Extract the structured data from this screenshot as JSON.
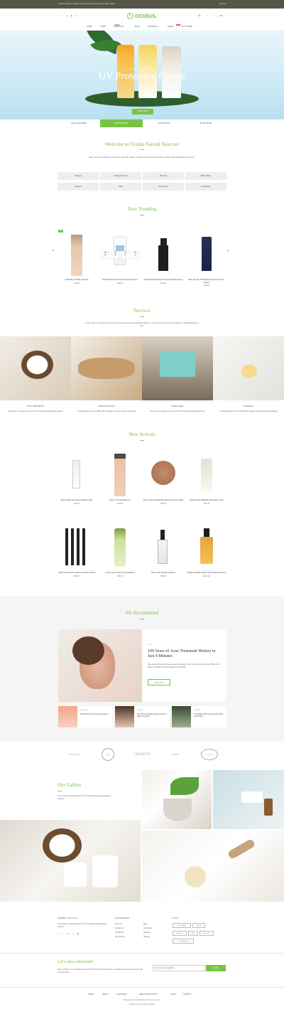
{
  "topbar": {
    "promo": "Get free Delivery, samples and gift boxes when you shop 200+ orders",
    "account": "Account"
  },
  "header": {
    "logo": "ocolus.",
    "currency": "INR",
    "cart_count": "0"
  },
  "nav": {
    "items": [
      "HOME",
      "SHOP",
      "PRODUCTS",
      "BLOG",
      "PORTFOLIO",
      "PAGES",
      "BUY THEME"
    ],
    "badges": {
      "products": "NEW",
      "pages": "HOT"
    }
  },
  "hero": {
    "tag": "NEW COLLECTION",
    "title": "UV Protection Cream",
    "button": "SHOP NOW",
    "colors": {
      "sky": "#cdeaf6",
      "accent": "#7cc242"
    }
  },
  "category_tabs": [
    "FACE CLEANSER",
    "MOISTURIZER",
    "FOUNDATION",
    "BLACK MASK"
  ],
  "welcome": {
    "title": "Welcome to Ocolus Natural Skincare",
    "text": "We're driven by discovery and work only with nature, creating powerful and effective certified natural skincare you'll love.",
    "pills": [
      "Makeup",
      "Makeup Brushes",
      "Skincare",
      "Bath & Body",
      "Haircare",
      "Nails",
      "Men's Care",
      "Accessories"
    ]
  },
  "trending": {
    "title": "Now Trending",
    "products": [
      {
        "name": "Ardell Dirty Peptide Cleanser",
        "price": "$32.00",
        "sale": "-15%"
      },
      {
        "name": "Pinkish & Perfect Intense Advanced Serum",
        "price": "$60.00"
      },
      {
        "name": "Advanced Night Repair Synchronized Recovery",
        "price": "$45.00"
      },
      {
        "name": "Take The Day Off Makeup Remover for Lids, Lashes",
        "price": "$25.00"
      }
    ],
    "countdown": [
      {
        "value": "36",
        "unit": "DAYS"
      },
      {
        "value": "04",
        "unit": "HRS"
      },
      {
        "value": "11",
        "unit": "MIN"
      },
      {
        "value": "52",
        "unit": "SEC"
      }
    ]
  },
  "services": {
    "title": "Services",
    "text": "Lorem Ipsum is simply dummy text of the printing and typesetting industry. Lorem Ipsum has been the industry's standard dummy text.",
    "items": [
      {
        "label": "BODY TREATMENTS",
        "text": "Lorem Ipsum is simply dummy text of the printing and typesetting industry."
      },
      {
        "label": "ORGANIC TOOLKITS",
        "text": "It was popularised in the 1960s with the release of Letraset sheets containing"
      },
      {
        "label": "HANDS & FEET",
        "text": "Lorem Ipsum is simply dummy text of the printing and typesetting industry."
      },
      {
        "label": "MASSAGES",
        "text": "It was popularised in the 1960s with the release of Letraset sheets containing"
      }
    ]
  },
  "arrivals": {
    "title": "New Arrivals",
    "products": [
      {
        "name": "Beauty Elixir with Intense Makeup Mist",
        "price": "$30.00"
      },
      {
        "name": "Sheer Tiny Foundation F3",
        "price": "$20.00"
      },
      {
        "name": "Mini Cocoa & Vanilla Mini Diamond Glow Powder",
        "price": "$25.00"
      },
      {
        "name": "Mineral Light Mattifying Sunscreen Lotion",
        "price": "$41.00"
      },
      {
        "name": "Studio Pro Precise & Define Duo Brow Pencil",
        "price": "$23.00"
      },
      {
        "name": "Online Only Foaming Clay Cleanser",
        "price": "$38.00"
      },
      {
        "name": "Online Only Peptide Cleanser",
        "price": "$35.00"
      },
      {
        "name": "Advanced Night Repair Concentrated Recovery",
        "price": "$230.00"
      }
    ]
  },
  "recommend": {
    "title": "We Recommend",
    "featured": {
      "category": "SKIN",
      "title": "100 Years of Acne Treatment History in Just 4 Minutes",
      "text": "Take a look at the last 100 years of acne treatments, from arsenic treatments in the 1900s, to UV lights in the 1960s, to beauty treatments of the 80s...",
      "button": "READ MORE"
    },
    "minis": [
      {
        "cat": "SKIN CARE",
        "title": "Don't Miss Cures For Skin Go Extinct"
      },
      {
        "cat": "MAKEUP",
        "title": "Get The Perfect Balm Lipstick Look No Matter Your Skin"
      },
      {
        "cat": "ORGANIC",
        "title": "5 Celebrities Who Swore by Their Best Facial Tools"
      }
    ]
  },
  "brands": [
    "MOUNTAIN",
    "LOGO",
    "CREATIVE",
    "BRAND",
    "CONCEPT"
  ],
  "gallery": {
    "title": "Our Gallery",
    "text": "Lorem Ipsum is simply dummy text of the printing and typesetting industry."
  },
  "footer": {
    "contact_head": "CONNECT WITH US",
    "contact_text": "Lorem Ipsum is simply dummy text of the printing and typesetting industry.",
    "info_head": "INFORMATION",
    "info_links": [
      "About Us",
      "Contact Us",
      "My Wishlist",
      "My Compare"
    ],
    "account_links": [
      "Blog",
      "Gift Voucher",
      "Specials",
      "Sitemap"
    ],
    "tags_head": "TAGS",
    "tags": [
      "Best Selling",
      "Beauty",
      "Body Oil",
      "Skin",
      "Spa Care",
      "Face Makeup"
    ],
    "newsletter_title": "Let's stay connected!",
    "newsletter_text": "Sign up today for our newsletter and receive 15% OFF your first purchase, and also get our latest beauty tips and exclusive offers.",
    "email_placeholder": "Enter your email address",
    "submit": "SEND",
    "bottom_links": [
      "HOME",
      "ABOUT",
      "LOOK BOOK",
      "FREE CONSULTATION",
      "BLOG",
      "CONTACT"
    ],
    "copyright1": "Natural beauty Shopify theme for your every store",
    "copyright2": "@2020 Ocolus. All rights reserved"
  }
}
